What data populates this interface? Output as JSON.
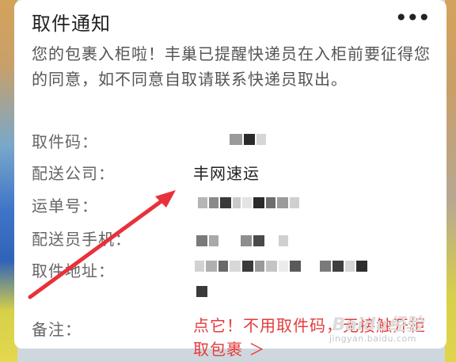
{
  "notice": {
    "title": "取件通知",
    "more_icon": "more-horizontal-icon",
    "more_glyph": "•••",
    "intro": "您的包裹入柜啦！丰巢已提醒快递员在入柜前要征得您的同意，如不同意自取请联系快递员取出。"
  },
  "fields": {
    "pickup_code_label": "取件码：",
    "courier_company_label": "配送公司：",
    "courier_company_value": "丰网速运",
    "waybill_label": "运单号：",
    "courier_phone_label": "配送员手机：",
    "pickup_address_label": "取件地址：",
    "remark_label": "备注：",
    "remark_value": "点它！不用取件码，无接触开柜取包裹 ＞"
  },
  "colors": {
    "remark_red": "#e53b3b",
    "arrow_red": "#e8313a"
  },
  "watermark": {
    "logo": "Baidu经验",
    "url": "jingyan.baidu.com"
  }
}
